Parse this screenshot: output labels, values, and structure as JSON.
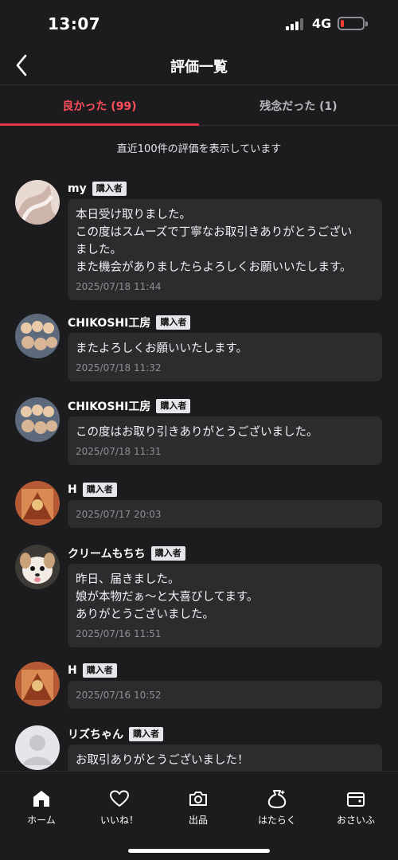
{
  "status_bar": {
    "time": "13:07",
    "network": "4G",
    "battery_level": 0.15,
    "battery_color": "#ff3b30"
  },
  "header": {
    "title": "評価一覧",
    "back_icon": "chevron-left-icon"
  },
  "tabs": [
    {
      "label": "良かった (99)",
      "active": true
    },
    {
      "label": "残念だった (1)",
      "active": false
    }
  ],
  "accent_color": "#e8334a",
  "notice": "直近100件の評価を表示しています",
  "reviews": [
    {
      "name": "my",
      "badge": "購入者",
      "comment": "本日受け取りました。\nこの度はスムーズで丁寧なお取引きありがとうござい\nました。\nまた機会がありましたらよろしくお願いいたします。",
      "time": "2025/07/18 11:44"
    },
    {
      "name": "CHIKOSHI工房",
      "badge": "購入者",
      "comment": "またよろしくお願いいたします。",
      "time": "2025/07/18 11:32"
    },
    {
      "name": "CHIKOSHI工房",
      "badge": "購入者",
      "comment": "この度はお取り引きありがとうございました。",
      "time": "2025/07/18 11:31"
    },
    {
      "name": "H",
      "badge": "購入者",
      "comment": "",
      "time": "2025/07/17 20:03"
    },
    {
      "name": "クリームもちち",
      "badge": "購入者",
      "comment": "昨日、届きました。\n娘が本物だぁ〜と大喜びしてます。\nありがとうございました。",
      "time": "2025/07/16 11:51"
    },
    {
      "name": "H",
      "badge": "購入者",
      "comment": "",
      "time": "2025/07/16 10:52"
    },
    {
      "name": "リズちゃん",
      "badge": "購入者",
      "comment": "お取引ありがとうございました！",
      "time": ""
    }
  ],
  "bottom_nav": [
    {
      "label": "ホーム",
      "icon": "home-icon"
    },
    {
      "label": "いいね！",
      "icon": "heart-icon"
    },
    {
      "label": "出品",
      "icon": "camera-icon"
    },
    {
      "label": "はたらく",
      "icon": "money-bag-icon"
    },
    {
      "label": "おさいふ",
      "icon": "wallet-icon"
    }
  ]
}
